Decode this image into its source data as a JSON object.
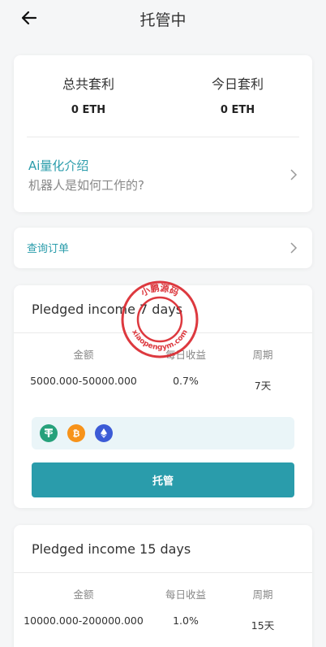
{
  "header": {
    "title": "托管中"
  },
  "stats": {
    "total_label": "总共套利",
    "total_value": "0 ETH",
    "today_label": "今日套利",
    "today_value": "0 ETH"
  },
  "intro": {
    "title": "Ai量化介绍",
    "subtitle": "机器人是如何工作的?"
  },
  "orders": {
    "label": "查询订单"
  },
  "plans": [
    {
      "title": "Pledged income 7 days",
      "headers": [
        "金额",
        "每日收益",
        "周期"
      ],
      "amount": "5000.000-50000.000",
      "daily": "0.7%",
      "period": "7天",
      "button": "托管",
      "coins": [
        "tether-icon",
        "bitcoin-icon",
        "ethereum-icon"
      ]
    },
    {
      "title": "Pledged income 15 days",
      "headers": [
        "金额",
        "每日收益",
        "周期"
      ],
      "amount": "10000.000-200000.000",
      "daily": "1.0%",
      "period": "15天"
    }
  ],
  "watermark": {
    "top_text": "小鹏源码",
    "bottom_text": "xiaopengym.com"
  },
  "colors": {
    "accent": "#2a9cab",
    "coin_box": "#eaf5f8",
    "tether": "#26a17b",
    "bitcoin": "#f7931a",
    "ethereum": "#3c5bd6",
    "stamp": "#d9232a"
  }
}
